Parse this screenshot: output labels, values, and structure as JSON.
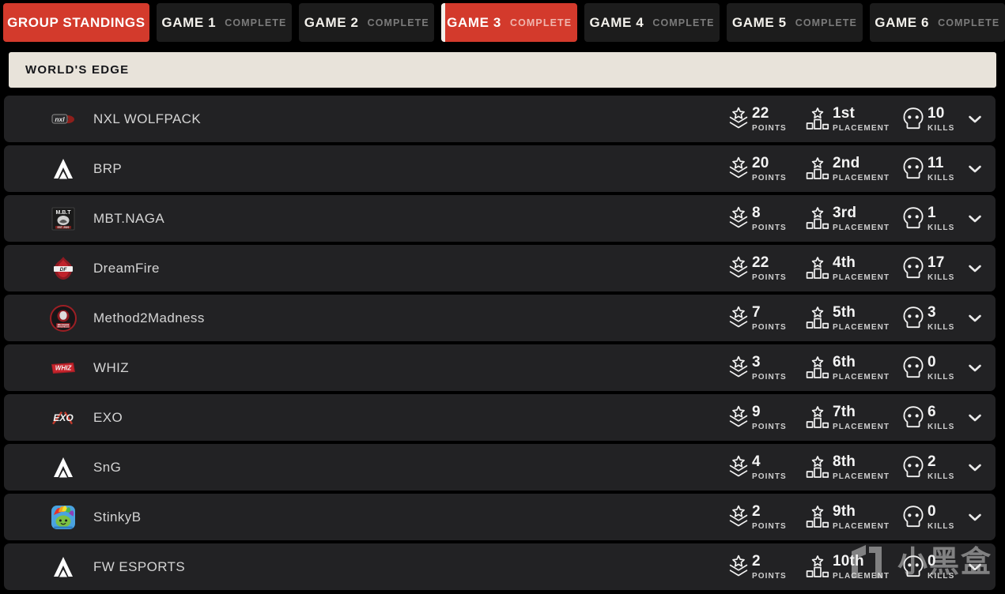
{
  "tabs": [
    {
      "label": "GROUP STANDINGS",
      "status": "",
      "active": true,
      "marker": false,
      "wide": true
    },
    {
      "label": "GAME 1",
      "status": "COMPLETE",
      "active": false,
      "marker": false,
      "wide": false
    },
    {
      "label": "GAME 2",
      "status": "COMPLETE",
      "active": false,
      "marker": false,
      "wide": false
    },
    {
      "label": "GAME 3",
      "status": "COMPLETE",
      "active": true,
      "marker": true,
      "wide": false
    },
    {
      "label": "GAME 4",
      "status": "COMPLETE",
      "active": false,
      "marker": false,
      "wide": false
    },
    {
      "label": "GAME 5",
      "status": "COMPLETE",
      "active": false,
      "marker": false,
      "wide": false
    },
    {
      "label": "GAME 6",
      "status": "COMPLETE",
      "active": false,
      "marker": false,
      "wide": false
    }
  ],
  "map_header": {
    "title": "WORLD'S EDGE"
  },
  "stat_labels": {
    "points": "POINTS",
    "placement": "PLACEMENT",
    "kills": "KILLS"
  },
  "icons": {
    "points": "rank-badge-icon",
    "placement": "podium-icon",
    "kills": "skull-icon",
    "expand": "chevron-down-icon"
  },
  "colors": {
    "accent_red": "#d33a2c",
    "row_bg": "#222224",
    "page_bg": "#000000",
    "header_bg": "#e8e3da",
    "tab_bg": "#1c1c1c"
  },
  "teams": [
    {
      "name": "NXL WOLFPACK",
      "logo": "nxl",
      "points": "22",
      "placement": "1st",
      "kills": "10"
    },
    {
      "name": "BRP",
      "logo": "apex",
      "points": "20",
      "placement": "2nd",
      "kills": "11"
    },
    {
      "name": "MBT.NAGA",
      "logo": "mbt",
      "points": "8",
      "placement": "3rd",
      "kills": "1"
    },
    {
      "name": "DreamFire",
      "logo": "df",
      "points": "22",
      "placement": "4th",
      "kills": "17"
    },
    {
      "name": "Method2Madness",
      "logo": "m2m",
      "points": "7",
      "placement": "5th",
      "kills": "3"
    },
    {
      "name": "WHIZ",
      "logo": "whiz",
      "points": "3",
      "placement": "6th",
      "kills": "0"
    },
    {
      "name": "EXO",
      "logo": "exo",
      "points": "9",
      "placement": "7th",
      "kills": "6"
    },
    {
      "name": "SnG",
      "logo": "apex",
      "points": "4",
      "placement": "8th",
      "kills": "2"
    },
    {
      "name": "StinkyB",
      "logo": "stinky",
      "points": "2",
      "placement": "9th",
      "kills": "0"
    },
    {
      "name": "FW ESPORTS",
      "logo": "apex",
      "points": "2",
      "placement": "10th",
      "kills": "0"
    }
  ],
  "watermark": {
    "text": "小黑盒"
  }
}
